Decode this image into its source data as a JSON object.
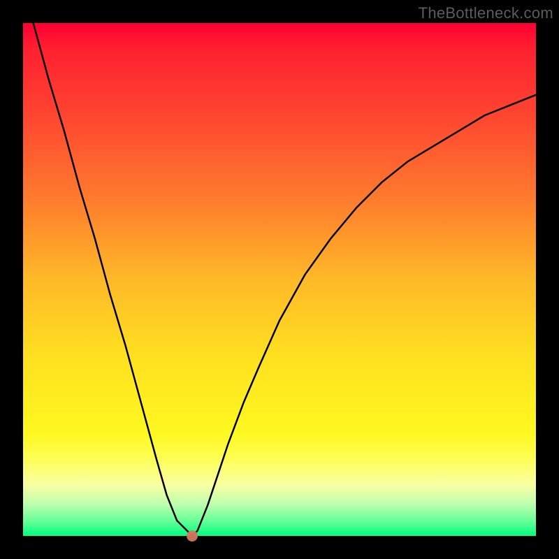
{
  "watermark": "TheBottleneck.com",
  "chart_data": {
    "type": "line",
    "title": "",
    "xlabel": "",
    "ylabel": "",
    "xlim": [
      0,
      100
    ],
    "ylim": [
      0,
      100
    ],
    "grid": false,
    "legend": false,
    "background_gradient": {
      "top": "#ff0033",
      "bottom": "#00ff80",
      "description": "red-to-green vertical gradient (bottleneck severity)"
    },
    "series": [
      {
        "name": "bottleneck-curve",
        "color": "#000000",
        "x": [
          2,
          5,
          8,
          11,
          14,
          17,
          20,
          23,
          26,
          28,
          30,
          32,
          33,
          34,
          36,
          38,
          40,
          43,
          46,
          50,
          55,
          60,
          65,
          70,
          75,
          80,
          85,
          90,
          95,
          100
        ],
        "values": [
          100,
          89,
          79,
          68,
          58,
          47,
          37,
          26,
          15,
          8,
          3,
          1,
          0,
          1,
          6,
          12,
          18,
          26,
          33,
          42,
          51,
          58,
          64,
          69,
          73,
          76,
          79,
          82,
          84,
          86
        ]
      }
    ],
    "marker": {
      "name": "optimal-point",
      "x": 33,
      "y": 0,
      "color": "#d47760"
    }
  }
}
